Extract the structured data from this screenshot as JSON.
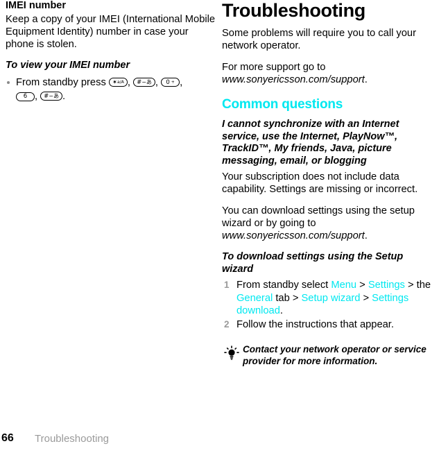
{
  "left_column": {
    "heading": "IMEI number",
    "paragraph": "Keep a copy of your IMEI (International Mobile Equipment Identity) number in case your phone is stolen.",
    "procedure_heading": "To view your IMEI number",
    "bullet_prefix": "From standby press",
    "keys": [
      {
        "name": "star-key",
        "main": "✶",
        "sup": "a/A"
      },
      {
        "name": "hash-key",
        "main": "#",
        "sup": "−あ"
      },
      {
        "name": "zero-key",
        "main": "0",
        "sup": "+"
      },
      {
        "name": "six-key",
        "main": "6",
        "sup": ""
      },
      {
        "name": "hash-key-2",
        "main": "#",
        "sup": "−あ"
      }
    ]
  },
  "right_column": {
    "chapter_title": "Troubleshooting",
    "intro_paragraph": "Some problems will require you to call your network operator.",
    "support_lead": "For more support go to ",
    "support_url": "www.sonyericsson.com/support",
    "support_period": ".",
    "section_heading": "Common questions",
    "question_heading": "I cannot synchronize with an Internet service, use the Internet, PlayNow™, TrackID™, My friends, Java, picture messaging, email, or blogging",
    "answer_paragraph": "Your subscription does not include data capability. Settings are missing or incorrect.",
    "download_lead": "You can download settings using the setup wizard or by going to ",
    "download_url": "www.sonyericsson.com/support",
    "download_period": ".",
    "procedure_heading": "To download settings using the Setup wizard",
    "steps": [
      {
        "number": "1",
        "segments": [
          {
            "text": "From standby select ",
            "style": "plain"
          },
          {
            "text": "Menu",
            "style": "menu"
          },
          {
            "text": " > ",
            "style": "plain"
          },
          {
            "text": "Settings",
            "style": "menu"
          },
          {
            "text": " > the ",
            "style": "plain"
          },
          {
            "text": "General",
            "style": "menu"
          },
          {
            "text": " tab > ",
            "style": "plain"
          },
          {
            "text": "Setup wizard",
            "style": "menu"
          },
          {
            "text": " > ",
            "style": "plain"
          },
          {
            "text": "Settings download",
            "style": "menu"
          },
          {
            "text": ".",
            "style": "plain"
          }
        ]
      },
      {
        "number": "2",
        "segments": [
          {
            "text": "Follow the instructions that appear.",
            "style": "plain"
          }
        ]
      }
    ],
    "tip": {
      "icon": "lightbulb-icon",
      "text": "Contact your network operator or service provider for more information."
    }
  },
  "footer": {
    "page_number": "66",
    "title": "Troubleshooting"
  },
  "colors": {
    "menu_accent": "#00E8F0",
    "step_number": "#9a9a9a",
    "footer_title": "#9a9a9a",
    "bullet": "#8a8a8a",
    "text": "#000000",
    "background": "#ffffff"
  }
}
